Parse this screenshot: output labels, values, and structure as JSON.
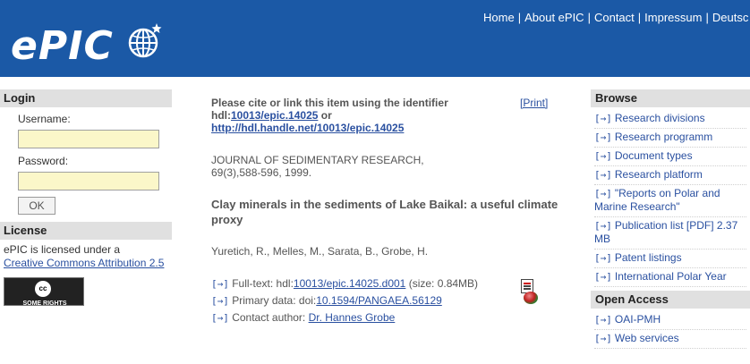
{
  "header": {
    "logo_text": "ePIC",
    "nav": [
      "Home",
      "About ePIC",
      "Contact",
      "Impressum",
      "Deutsc"
    ]
  },
  "login": {
    "heading": "Login",
    "username_label": "Username:",
    "username_value": "",
    "password_label": "Password:",
    "password_value": "",
    "ok_label": "OK"
  },
  "license": {
    "heading": "License",
    "text": "ePIC is licensed under a",
    "link": "Creative Commons Attribution 2.5",
    "badge_symbol": "cc",
    "badge_text": "SOME RIGHTS RESERVED"
  },
  "main": {
    "cite_intro": "Please cite or link this item using the identifier",
    "hdl_prefix": "hdl:",
    "hdl_id": "10013/epic.14025",
    "or_text": " or",
    "handle_url": "http://hdl.handle.net/10013/epic.14025",
    "print_label": "[Print]",
    "journal_line1": "JOURNAL OF SEDIMENTARY RESEARCH,",
    "journal_line2": "69(3),588-596, 1999.",
    "title": "Clay minerals in the sediments of Lake Baikal: a useful climate proxy",
    "authors": "Yuretich, R., Melles, M., Sarata, B., Grobe, H.",
    "arrow": "[→]",
    "fulltext_prefix": " Full-text: hdl:",
    "fulltext_link": "10013/epic.14025.d001",
    "fulltext_size": " (size: 0.84MB)",
    "primary_prefix": " Primary data: doi:",
    "primary_link": "10.1594/PANGAEA.56129",
    "contact_prefix": " Contact author: ",
    "contact_link": "Dr. Hannes Grobe"
  },
  "browse": {
    "heading": "Browse",
    "items": [
      "Research divisions",
      "Research programm",
      "Document types",
      "Research platform",
      "\"Reports on Polar and Marine Research\"",
      "Publication list [PDF] 2.37 MB",
      "Patent listings",
      "International Polar Year"
    ]
  },
  "open_access": {
    "heading": "Open Access",
    "items": [
      "OAI-PMH",
      "Web services"
    ]
  }
}
